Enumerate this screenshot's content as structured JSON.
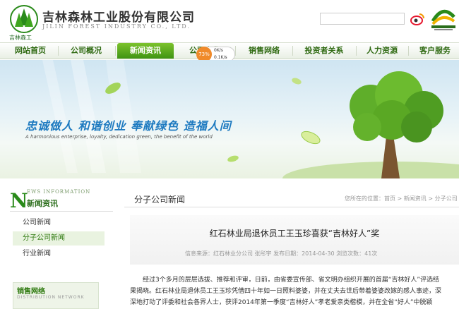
{
  "header": {
    "company_name": "吉林森林工业股份有限公司",
    "company_en": "JILIN FOREST INDUSTRY CO., LTD.",
    "logo_text": "吉林森工"
  },
  "nav": {
    "items": [
      {
        "label": "网站首页"
      },
      {
        "label": "公司概况"
      },
      {
        "label": "新闻资讯"
      },
      {
        "label": "公司文化"
      },
      {
        "label": "销售网络"
      },
      {
        "label": "投资者关系"
      },
      {
        "label": "人力资源"
      },
      {
        "label": "客户服务"
      }
    ],
    "active_index": 2
  },
  "speed_widget": {
    "percent": "73%",
    "up": "0K/s",
    "down": "0.1K/s"
  },
  "banner": {
    "slogan": "忠诚做人  和谐创业  奉献绿色  造福人间",
    "slogan_en": "A harmonious enterprise, loyalty, dedication green, the benefit of the world"
  },
  "sidebar": {
    "title_letter": "N",
    "title_en": "EWS INFORMATION",
    "title_cn": "新闻资讯",
    "items": [
      {
        "label": "公司新闻"
      },
      {
        "label": "分子公司新闻"
      },
      {
        "label": "行业新闻"
      }
    ],
    "active_index": 1,
    "distribution_cn": "销售网络",
    "distribution_en": "DISTRIBUTION NETWORK"
  },
  "main": {
    "section_title": "分子公司新闻",
    "breadcrumb": "您所在的位置：首页 > 新闻资讯 > 分子公司",
    "article_title": "红石林业局退休员工王玉珍喜获“吉林好人”奖",
    "meta": "信息来源：红石林业分公司 张彤宇      发布日期：2014-04-30      浏览次数：41次",
    "paragraph_lines": [
      "经过3个多月的层层选拔、推荐和评审，日前，由省委宣传部、省文明办组织开展的首届“吉林好人”评选结",
      "果揭晓。红石林业局退休员工王玉珍凭借四十年如一日照料婆婆，并在丈夫去世后带着婆婆改嫁的感人事迹，深",
      "深地打动了评委和社会各界人士，获评2014年第一季度“吉林好人”孝老爱亲类楷模，并在全省“好人”中脱颖"
    ]
  },
  "colors": {
    "brand_green": "#3f9413",
    "slogan_blue": "#1e7ac0",
    "widget_orange": "#f08a2a"
  }
}
